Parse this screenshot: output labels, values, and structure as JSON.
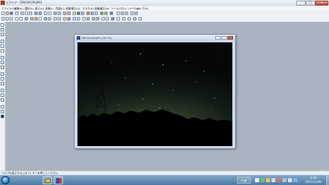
{
  "app": {
    "title": "ビクシア - [DSC00139.JPG]"
  },
  "menubar": {
    "items": [
      {
        "label": "ファイル(F)"
      },
      {
        "label": "編集(E)"
      },
      {
        "label": "選択(S)"
      },
      {
        "label": "表示(V)"
      },
      {
        "label": "画像(I)"
      },
      {
        "label": "色調(C)"
      },
      {
        "label": "画質補正(Q)"
      },
      {
        "label": "マスク(K)"
      },
      {
        "label": "画像補正(M)"
      },
      {
        "label": "ツール(T)"
      },
      {
        "label": "ウィンドウ(W)"
      },
      {
        "label": "ヘルプ(H)"
      }
    ]
  },
  "toolbar_icons": [
    "new-icon",
    "open-icon",
    "save-icon",
    "print-icon",
    "cut-icon",
    "copy-icon",
    "paste-icon",
    "undo-icon",
    "redo-icon",
    "zoom-in-icon",
    "zoom-out-icon",
    "rotate-icon",
    "flip-icon",
    "crop-icon",
    "resize-icon",
    "brightness-icon",
    "contrast-icon",
    "levels-icon",
    "color-icon",
    "sharpen-icon",
    "blur-icon",
    "mask-icon",
    "layer-icon",
    "help-icon"
  ],
  "image_window": {
    "title": "DSC00139.JPG (16.7%)"
  },
  "status": {
    "text": "ヘルプを表示するには F1 キーを押してください"
  },
  "taskbar": {
    "ime": "A 般",
    "time": "4:38",
    "date": "2011/11/06"
  },
  "colors": {
    "sky_dark": "#050807",
    "sky_glow": "#5a5a28",
    "treeline": "#000000",
    "taskbar": "#4f7ba3",
    "accent": "#2d7bc4"
  }
}
